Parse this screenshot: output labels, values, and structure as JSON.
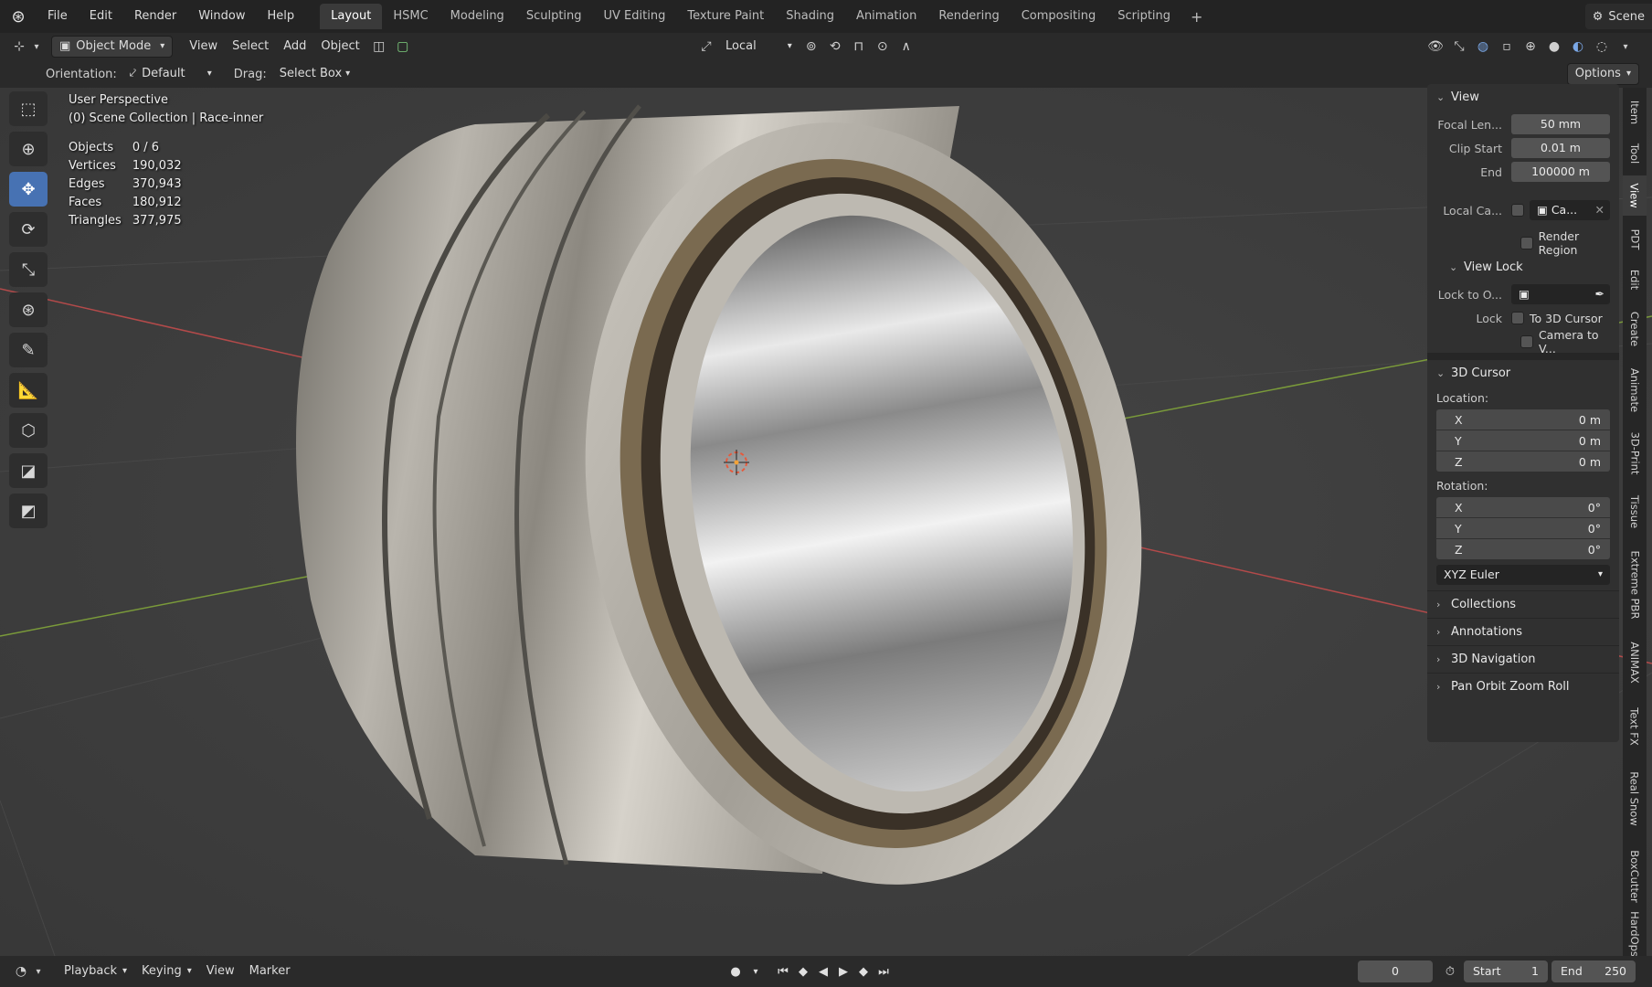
{
  "topbar": {
    "menus": [
      "File",
      "Edit",
      "Render",
      "Window",
      "Help"
    ],
    "workspaces": [
      "Layout",
      "HSMC",
      "Modeling",
      "Sculpting",
      "UV Editing",
      "Texture Paint",
      "Shading",
      "Animation",
      "Rendering",
      "Compositing",
      "Scripting"
    ],
    "active_workspace": "Layout",
    "add_workspace": "+",
    "scene_label": "Scene"
  },
  "header": {
    "mode": "Object Mode",
    "menus": [
      "View",
      "Select",
      "Add",
      "Object"
    ],
    "transform_space": "Local",
    "orientation_label": "Orientation:",
    "orientation_value": "Default",
    "drag_label": "Drag:",
    "drag_value": "Select Box",
    "options": "Options"
  },
  "overlay": {
    "perspective": "User Perspective",
    "collection": "(0) Scene Collection | Race-inner",
    "stats": [
      {
        "label": "Objects",
        "value": "0 / 6"
      },
      {
        "label": "Vertices",
        "value": "190,032"
      },
      {
        "label": "Edges",
        "value": "370,943"
      },
      {
        "label": "Faces",
        "value": "180,912"
      },
      {
        "label": "Triangles",
        "value": "377,975"
      }
    ]
  },
  "npanel": {
    "view": {
      "title": "View",
      "focal_label": "Focal Len...",
      "focal_value": "50 mm",
      "clip_start_label": "Clip Start",
      "clip_start_value": "0.01 m",
      "clip_end_label": "End",
      "clip_end_value": "100000 m",
      "local_camera_label": "Local Ca...",
      "local_camera_value": "Ca...",
      "render_region": "Render Region"
    },
    "view_lock": {
      "title": "View Lock",
      "lock_to_label": "Lock to O...",
      "lock_label": "Lock",
      "to_cursor": "To 3D Cursor",
      "camera_to_view": "Camera to V..."
    },
    "cursor": {
      "title": "3D Cursor",
      "location_label": "Location:",
      "location": [
        {
          "axis": "X",
          "value": "0 m"
        },
        {
          "axis": "Y",
          "value": "0 m"
        },
        {
          "axis": "Z",
          "value": "0 m"
        }
      ],
      "rotation_label": "Rotation:",
      "rotation": [
        {
          "axis": "X",
          "value": "0°"
        },
        {
          "axis": "Y",
          "value": "0°"
        },
        {
          "axis": "Z",
          "value": "0°"
        }
      ],
      "rotation_mode": "XYZ Euler"
    },
    "collapsed_panels": [
      "Collections",
      "Annotations",
      "3D Navigation",
      "Pan Orbit Zoom Roll"
    ]
  },
  "side_tabs": [
    "Item",
    "Tool",
    "View",
    "PDT",
    "Edit",
    "Create",
    "Animate",
    "3D-Print",
    "Tissue",
    "Extreme PBR",
    "ANIMAX",
    "Text FX",
    "Real Snow",
    "BoxCutter",
    "HardOps"
  ],
  "active_side_tab": "View",
  "timeline": {
    "menus": [
      "Playback",
      "Keying",
      "View",
      "Marker"
    ],
    "current_frame": "0",
    "start_label": "Start",
    "start_value": "1",
    "end_label": "End",
    "end_value": "250"
  },
  "colors": {
    "accent": "#4772b3",
    "viewport_bg": "#3d3d3d",
    "x_axis": "#b34a4a",
    "y_axis": "#7a9a3a"
  }
}
